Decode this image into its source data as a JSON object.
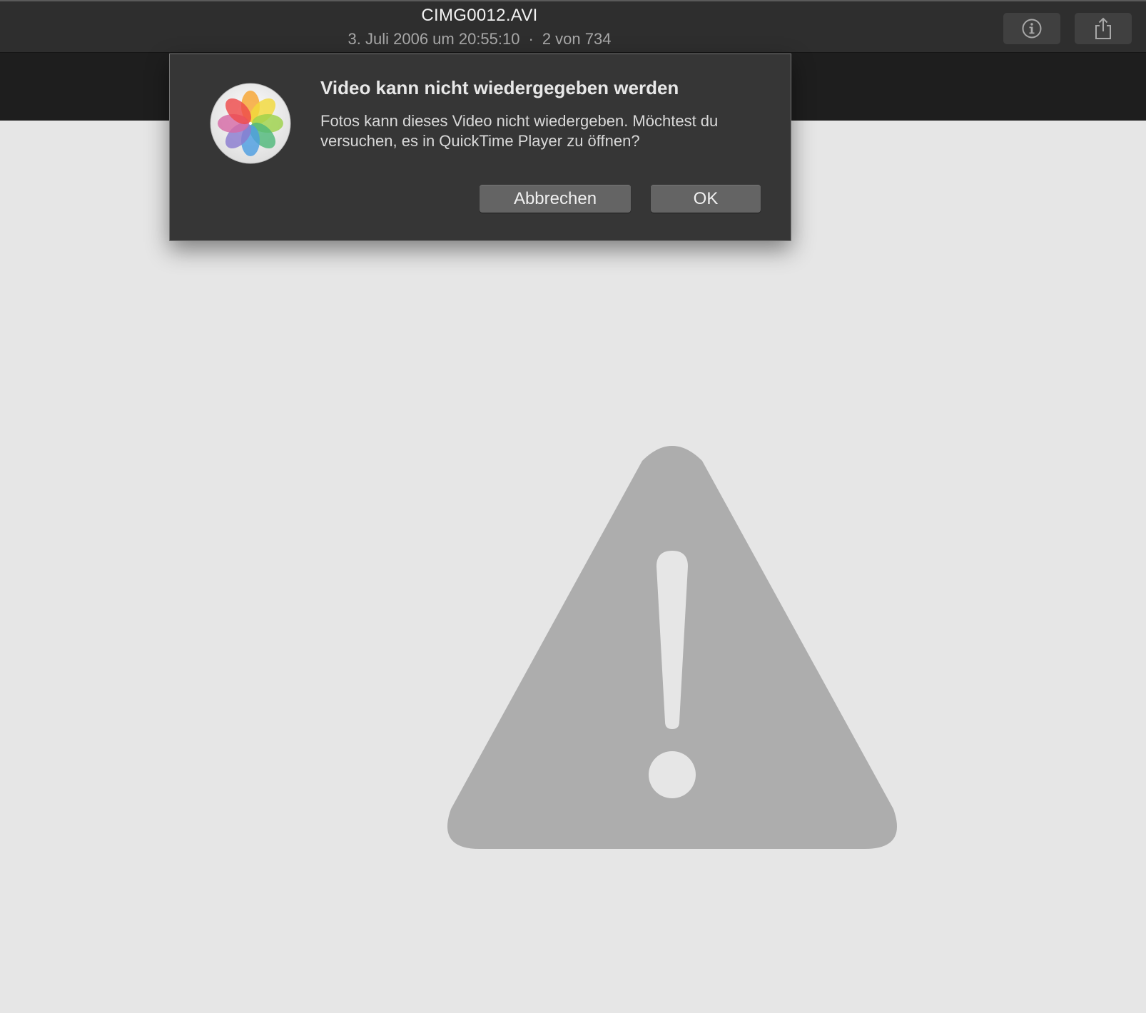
{
  "window": {
    "file_name": "CIMG0012.AVI",
    "date": "3. Juli 2006 um 20:55:10",
    "separator": "·",
    "position": "2 von 734"
  },
  "toolbar": {
    "info_icon": "info-icon",
    "share_icon": "share-icon"
  },
  "dialog": {
    "title": "Video kann nicht wiedergegeben werden",
    "message": "Fotos kann dieses Video nicht wiedergeben. Möchtest du versuchen, es in QuickTime Player zu öffnen?",
    "cancel_label": "Abbrechen",
    "ok_label": "OK",
    "icon": "photos-app-icon"
  },
  "content": {
    "icon": "warning-triangle-icon"
  },
  "colors": {
    "titlebar": "#2e2e2e",
    "dialog": "#363636",
    "content_bg": "#e6e6e6",
    "warning": "#adadad"
  }
}
